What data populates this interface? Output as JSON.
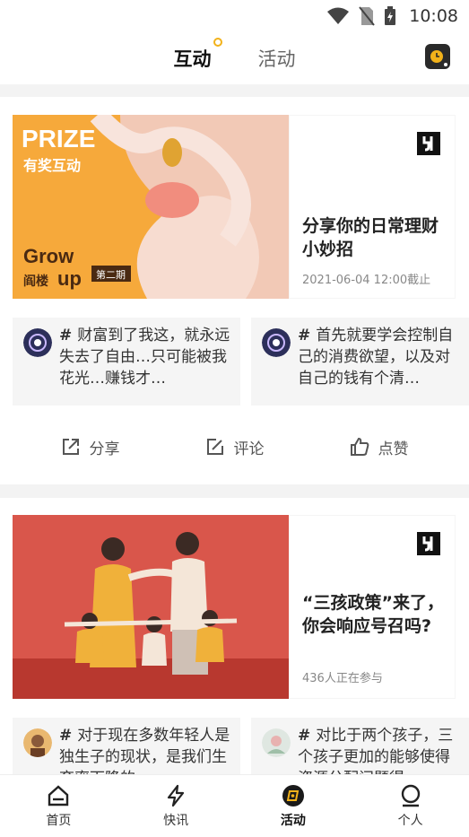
{
  "status_bar": {
    "time": "10:08"
  },
  "top_tabs": [
    {
      "label": "互动",
      "active": true
    },
    {
      "label": "活动",
      "active": false
    }
  ],
  "cards": [
    {
      "banner": {
        "prize": "PRIZE",
        "subtitle": "有奖互动",
        "grow": "Grow",
        "up_prefix": "阎楼",
        "up": "up",
        "issue": "第二期"
      },
      "title": "分享你的日常理财小妙招",
      "meta": "2021-06-04 12:00截止",
      "comments": [
        {
          "hash": "#",
          "text": "财富到了我这，就永远失去了自由…只可能被我花光…赚钱才…"
        },
        {
          "hash": "#",
          "text": "首先就要学会控制自己的消费欲望，以及对自己的钱有个清…"
        }
      ],
      "actions": {
        "share": "分享",
        "comment": "评论",
        "like": "点赞"
      }
    },
    {
      "title": "“三孩政策”来了，你会响应号召吗?",
      "meta": "436人正在参与",
      "comments": [
        {
          "hash": "#",
          "text": "对于现在多数年轻人是独生子的现状，是我们生育率下降的…"
        },
        {
          "hash": "#",
          "text": "对比于两个孩子，三个孩子更加的能够使得资源分配问题得…"
        }
      ]
    }
  ],
  "bottom_nav": [
    {
      "label": "首页",
      "icon": "home-icon",
      "active": false
    },
    {
      "label": "快讯",
      "icon": "flash-icon",
      "active": false
    },
    {
      "label": "活动",
      "icon": "activity-icon",
      "active": true
    },
    {
      "label": "个人",
      "icon": "profile-icon",
      "active": false
    }
  ],
  "colors": {
    "accent": "#f2b21a",
    "banner1_bg": "#f6a93b",
    "banner2_bg": "#d9564b"
  }
}
